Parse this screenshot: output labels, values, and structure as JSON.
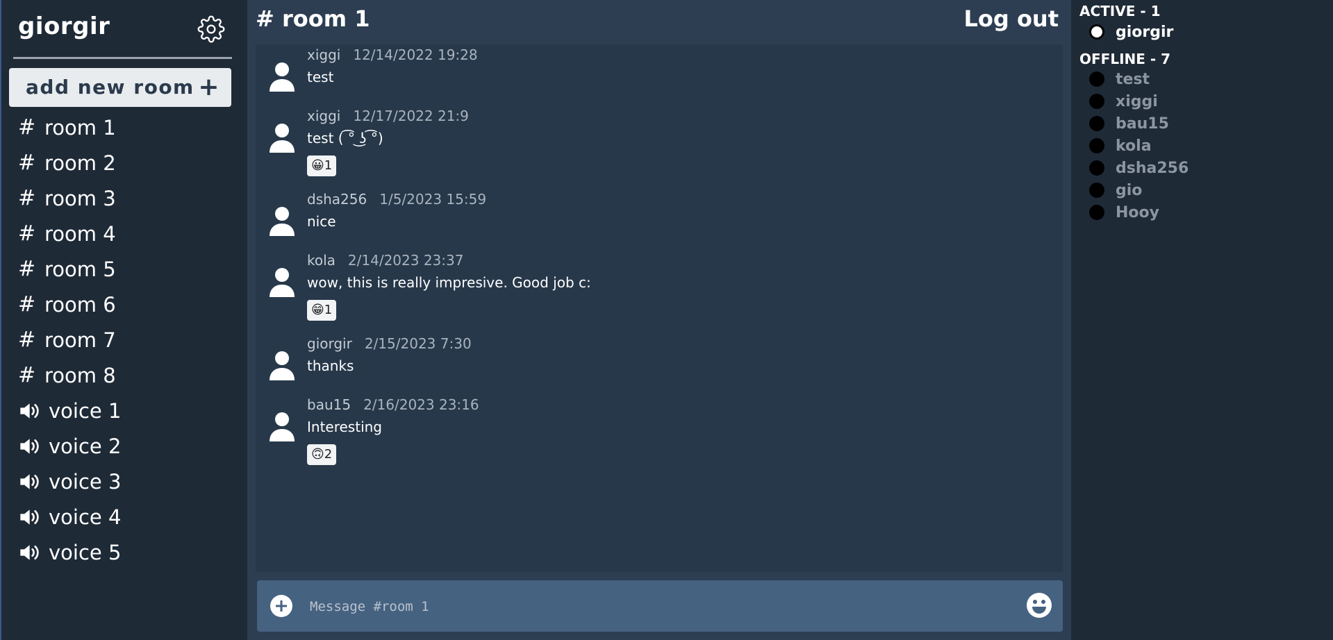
{
  "sidebar": {
    "username": "giorgir",
    "add_room_label": "add new room",
    "add_room_plus": "+",
    "rooms": [
      {
        "label": "room 1"
      },
      {
        "label": "room 2"
      },
      {
        "label": "room 3"
      },
      {
        "label": "room 4"
      },
      {
        "label": "room 5"
      },
      {
        "label": "room 6"
      },
      {
        "label": "room 7"
      },
      {
        "label": "room 8"
      }
    ],
    "voice": [
      {
        "label": "voice 1"
      },
      {
        "label": "voice 2"
      },
      {
        "label": "voice 3"
      },
      {
        "label": "voice 4"
      },
      {
        "label": "voice 5"
      }
    ]
  },
  "header": {
    "room_title": "# room 1",
    "logout_label": "Log out"
  },
  "messages": [
    {
      "author": "xiggi",
      "time": "12/14/2022 19:28",
      "text": "test",
      "reaction": ""
    },
    {
      "author": "xiggi",
      "time": "12/17/2022 21:9",
      "text": "test ( ͡° ͜ʖ ͡°)",
      "reaction": "😀1"
    },
    {
      "author": "dsha256",
      "time": "1/5/2023 15:59",
      "text": "nice",
      "reaction": ""
    },
    {
      "author": "kola",
      "time": "2/14/2023 23:37",
      "text": "wow, this is really impresive. Good job c:",
      "reaction": "😁1"
    },
    {
      "author": "giorgir",
      "time": "2/15/2023 7:30",
      "text": "thanks",
      "reaction": ""
    },
    {
      "author": "bau15",
      "time": "2/16/2023 23:16",
      "text": "Interesting",
      "reaction": "🙃2"
    }
  ],
  "composer": {
    "placeholder": "Message #room 1",
    "value": ""
  },
  "users": {
    "active_title": "ACTIVE - 1",
    "active": [
      "giorgir"
    ],
    "offline_title": "OFFLINE - 7",
    "offline": [
      "test",
      "xiggi",
      "bau15",
      "kola",
      "dsha256",
      "gio",
      "Hooy"
    ]
  },
  "icons": {
    "settings": "gear-icon",
    "voice": "speaker-icon",
    "avatar": "user-avatar-icon",
    "attach": "plus-circle-icon",
    "emoji": "smiley-icon"
  },
  "colors": {
    "sidebar_bg": "#1f2a37",
    "main_bg": "#2d3e52",
    "messages_bg": "#27384a",
    "composer_bg": "#466281",
    "button_bg": "#e8ecef"
  }
}
